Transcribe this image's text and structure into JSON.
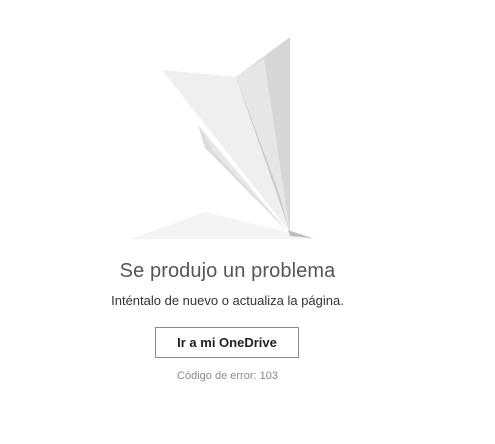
{
  "error": {
    "title": "Se produjo un problema",
    "message": "Inténtalo de nuevo o actualiza la página.",
    "button_label": "Ir a mi OneDrive",
    "code_text": "Código de error: 103"
  },
  "illustration": {
    "icon": "paper-plane-icon"
  }
}
